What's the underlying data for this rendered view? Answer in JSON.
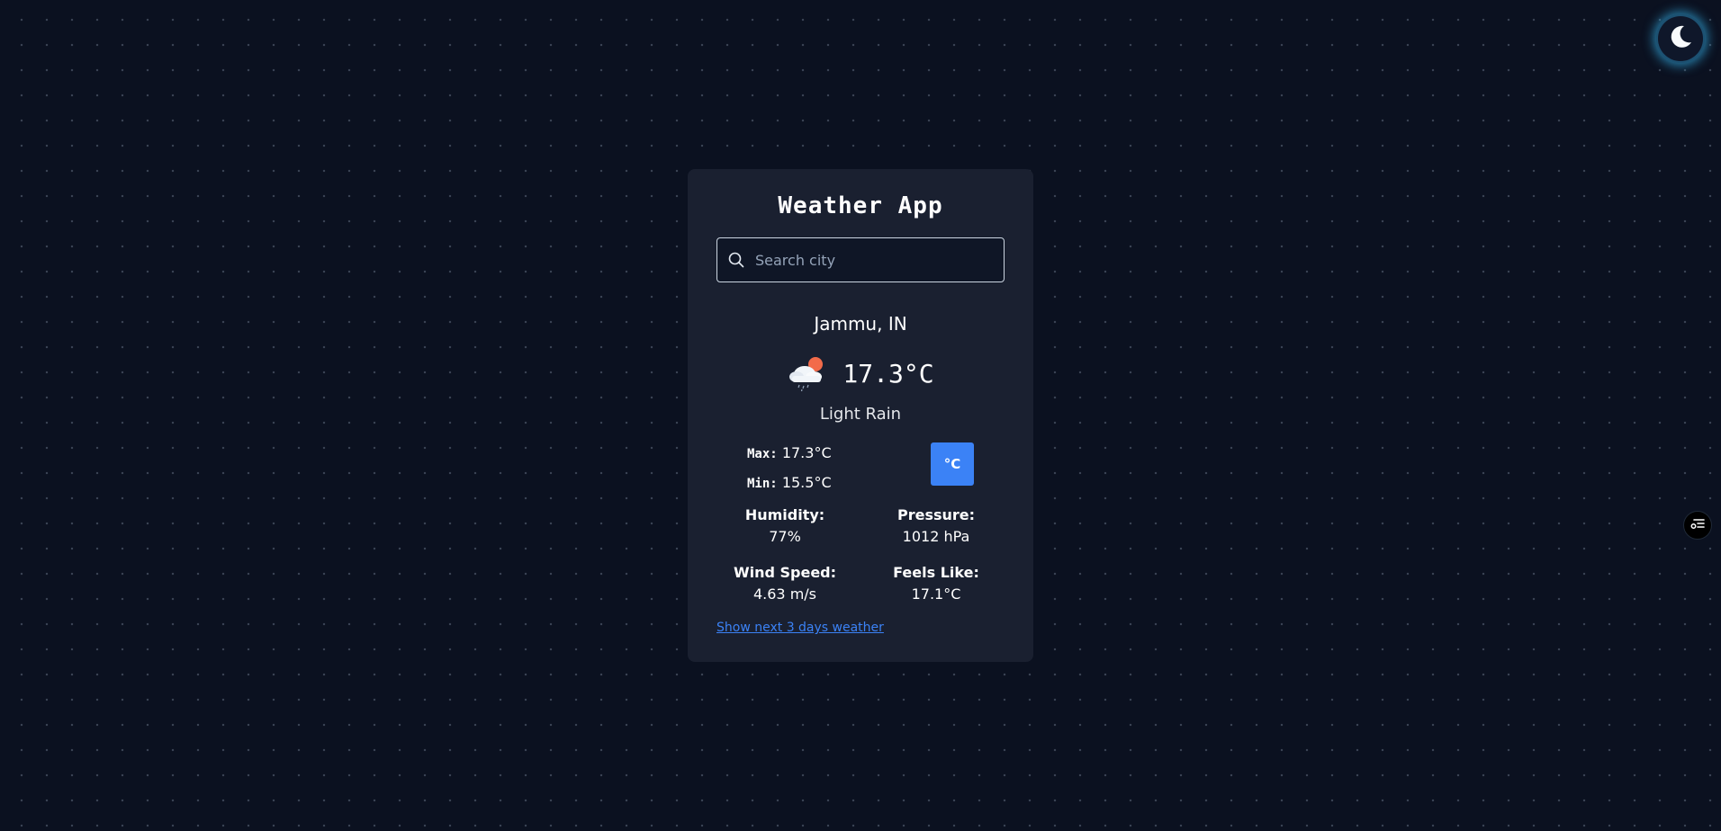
{
  "theme_toggle": {
    "icon": "moon-icon"
  },
  "side_button": {
    "icon": "filter-list-icon"
  },
  "card": {
    "title": "Weather App",
    "search": {
      "placeholder": "Search city",
      "value": ""
    },
    "location": "Jammu, IN",
    "weather_icon": "cloud-sun-rain-icon",
    "temperature": "17.3°C",
    "condition": "Light Rain",
    "max_label": "Max:",
    "max_value": "17.3°C",
    "min_label": "Min:",
    "min_value": "15.5°C",
    "unit_button": "°C",
    "humidity": {
      "label": "Humidity:",
      "value": "77%"
    },
    "pressure": {
      "label": "Pressure:",
      "value": "1012 hPa"
    },
    "wind_speed": {
      "label": "Wind Speed:",
      "value": "4.63 m/s"
    },
    "feels_like": {
      "label": "Feels Like:",
      "value": "17.1°C"
    },
    "forecast_link": "Show next 3 days weather"
  },
  "colors": {
    "background": "#0b1120",
    "card": "#1a2030",
    "accent": "#3b82f6",
    "glow": "#38bdf8"
  }
}
